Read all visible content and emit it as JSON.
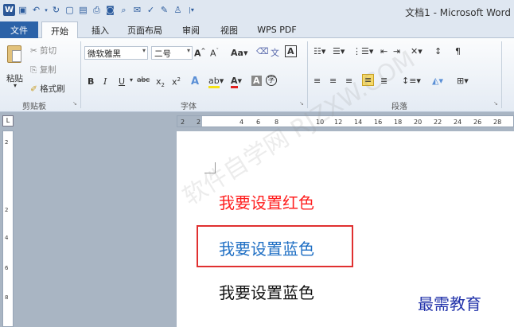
{
  "window": {
    "title": "文档1 - Microsoft Word"
  },
  "quick_access": [
    "w-logo-icon",
    "save-icon",
    "undo-icon",
    "redo-icon",
    "new-icon",
    "open-icon",
    "print-icon",
    "preview-icon",
    "mail-icon",
    "spell-icon",
    "format-icon",
    "more-icon"
  ],
  "tabs": [
    {
      "id": "file",
      "label": "文件"
    },
    {
      "id": "home",
      "label": "开始"
    },
    {
      "id": "insert",
      "label": "插入"
    },
    {
      "id": "layout",
      "label": "页面布局"
    },
    {
      "id": "review",
      "label": "审阅"
    },
    {
      "id": "view",
      "label": "视图"
    },
    {
      "id": "wps",
      "label": "WPS PDF"
    }
  ],
  "clipboard": {
    "paste": "粘贴",
    "cut": "剪切",
    "copy": "复制",
    "format_painter": "格式刷",
    "group": "剪贴板"
  },
  "font": {
    "name": "微软雅黑",
    "size": "二号",
    "group": "字体",
    "aa_label": "Aa",
    "wen_label": "A"
  },
  "paragraph": {
    "group": "段落"
  },
  "ruler": {
    "h_ticks": [
      "2",
      "2",
      "4",
      "6",
      "8",
      "10",
      "12",
      "14",
      "16",
      "18",
      "20",
      "22",
      "24",
      "26",
      "28"
    ],
    "v_ticks": [
      "2",
      "2",
      "4",
      "6",
      "8"
    ]
  },
  "document": {
    "lines": [
      {
        "text": "我要设置红色",
        "color": "#ff2020"
      },
      {
        "text": "我要设置蓝色",
        "color": "#1f6fc4"
      },
      {
        "text": "我要设置蓝色",
        "color": "#111111"
      }
    ],
    "watermark": "软件自学网 RJZXW.COM",
    "highlight_color": "#e03030"
  },
  "brand_overlay": "最需教育"
}
